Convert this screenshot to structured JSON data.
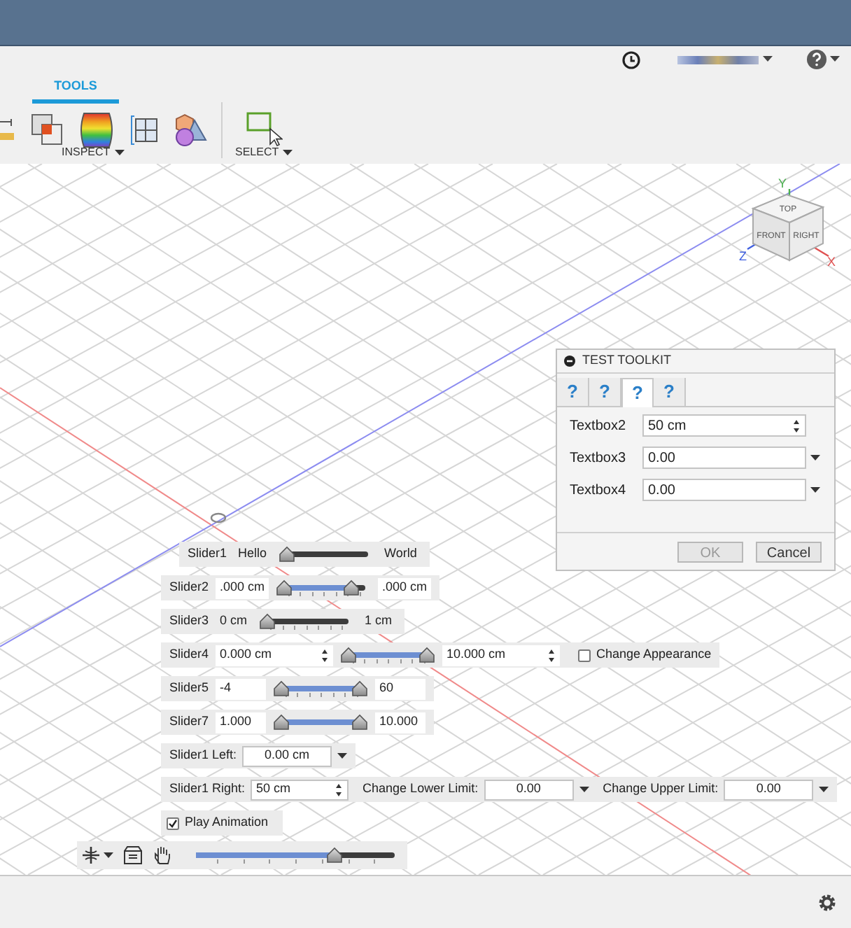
{
  "toolbar": {
    "tabs": [
      {
        "label": "TOOLS",
        "selected": true
      }
    ],
    "groups": [
      {
        "label": "INSPECT"
      },
      {
        "label": "SELECT"
      }
    ]
  },
  "dialog": {
    "title": "TEST TOOLKIT",
    "tabs": [
      {
        "label": "?",
        "selected": false
      },
      {
        "label": "?",
        "selected": false
      },
      {
        "label": "?",
        "selected": true
      },
      {
        "label": "?",
        "selected": false
      }
    ],
    "fields": [
      {
        "label": "Textbox2",
        "value": "50 cm",
        "kind": "spinner"
      },
      {
        "label": "Textbox3",
        "value": "0.00",
        "kind": "dropdown"
      },
      {
        "label": "Textbox4",
        "value": "0.00",
        "kind": "dropdown"
      }
    ],
    "buttons": [
      {
        "label": "OK",
        "disabled": true
      },
      {
        "label": "Cancel",
        "disabled": false
      }
    ]
  },
  "sliders": [
    {
      "label": "Slider1",
      "left": {
        "text": "Hello",
        "kind": "label"
      },
      "right": {
        "text": "World",
        "kind": "label"
      },
      "ticks": false,
      "thumbs": [
        {
          "level": 0
        }
      ]
    },
    {
      "label": "Slider2",
      "left": {
        "text": ".000 cm",
        "kind": "field"
      },
      "right": {
        "text": ".000 cm",
        "kind": "field"
      },
      "ticks": true,
      "thumbs": [
        {
          "level": 0
        },
        {
          "level": 0.85
        }
      ]
    },
    {
      "label": "Slider3",
      "left": {
        "text": "0 cm",
        "kind": "label"
      },
      "right": {
        "text": "1 cm",
        "kind": "label"
      },
      "ticks": true,
      "thumbs": [
        {
          "level": 0
        }
      ]
    },
    {
      "label": "Slider4",
      "left": {
        "text": "0.000 cm",
        "kind": "spinner"
      },
      "right": {
        "text": "10.000 cm",
        "kind": "spinner"
      },
      "ticks": true,
      "thumbs": [
        {
          "level": 0
        },
        {
          "level": 1
        }
      ],
      "checkbox": {
        "label": "Change Appearance",
        "checked": false
      }
    },
    {
      "label": "Slider5",
      "left": {
        "text": "-4",
        "kind": "field"
      },
      "right": {
        "text": "60",
        "kind": "field"
      },
      "ticks": true,
      "thumbs": [
        {
          "level": 0
        },
        {
          "level": 1
        }
      ]
    },
    {
      "label": "Slider7",
      "left": {
        "text": "1.000",
        "kind": "field"
      },
      "right": {
        "text": "10.000",
        "kind": "field"
      },
      "ticks": false,
      "thumbs": [
        {
          "level": 0
        },
        {
          "level": 1
        }
      ]
    }
  ],
  "limit_rows": [
    [
      {
        "label": "Slider1 Left:",
        "value": "0.00 cm",
        "kind": "dropdown"
      }
    ],
    [
      {
        "label": "Slider1 Right:",
        "value": "50 cm",
        "kind": "spinner"
      },
      {
        "label": "Change Lower Limit:",
        "value": "0.00",
        "kind": "dropdown"
      },
      {
        "label": "Change Upper Limit:",
        "value": "0.00",
        "kind": "dropdown"
      }
    ]
  ],
  "play_animation": {
    "label": "Play Animation",
    "checked": true
  },
  "timeline": {
    "level": 0.7
  },
  "view_cube": {
    "faces": [
      "TOP",
      "FRONT",
      "RIGHT"
    ],
    "axes": [
      {
        "label": "Y",
        "color": "#4caf50"
      },
      {
        "label": "Z",
        "color": "#4060e0"
      },
      {
        "label": "X",
        "color": "#e05050"
      }
    ]
  }
}
